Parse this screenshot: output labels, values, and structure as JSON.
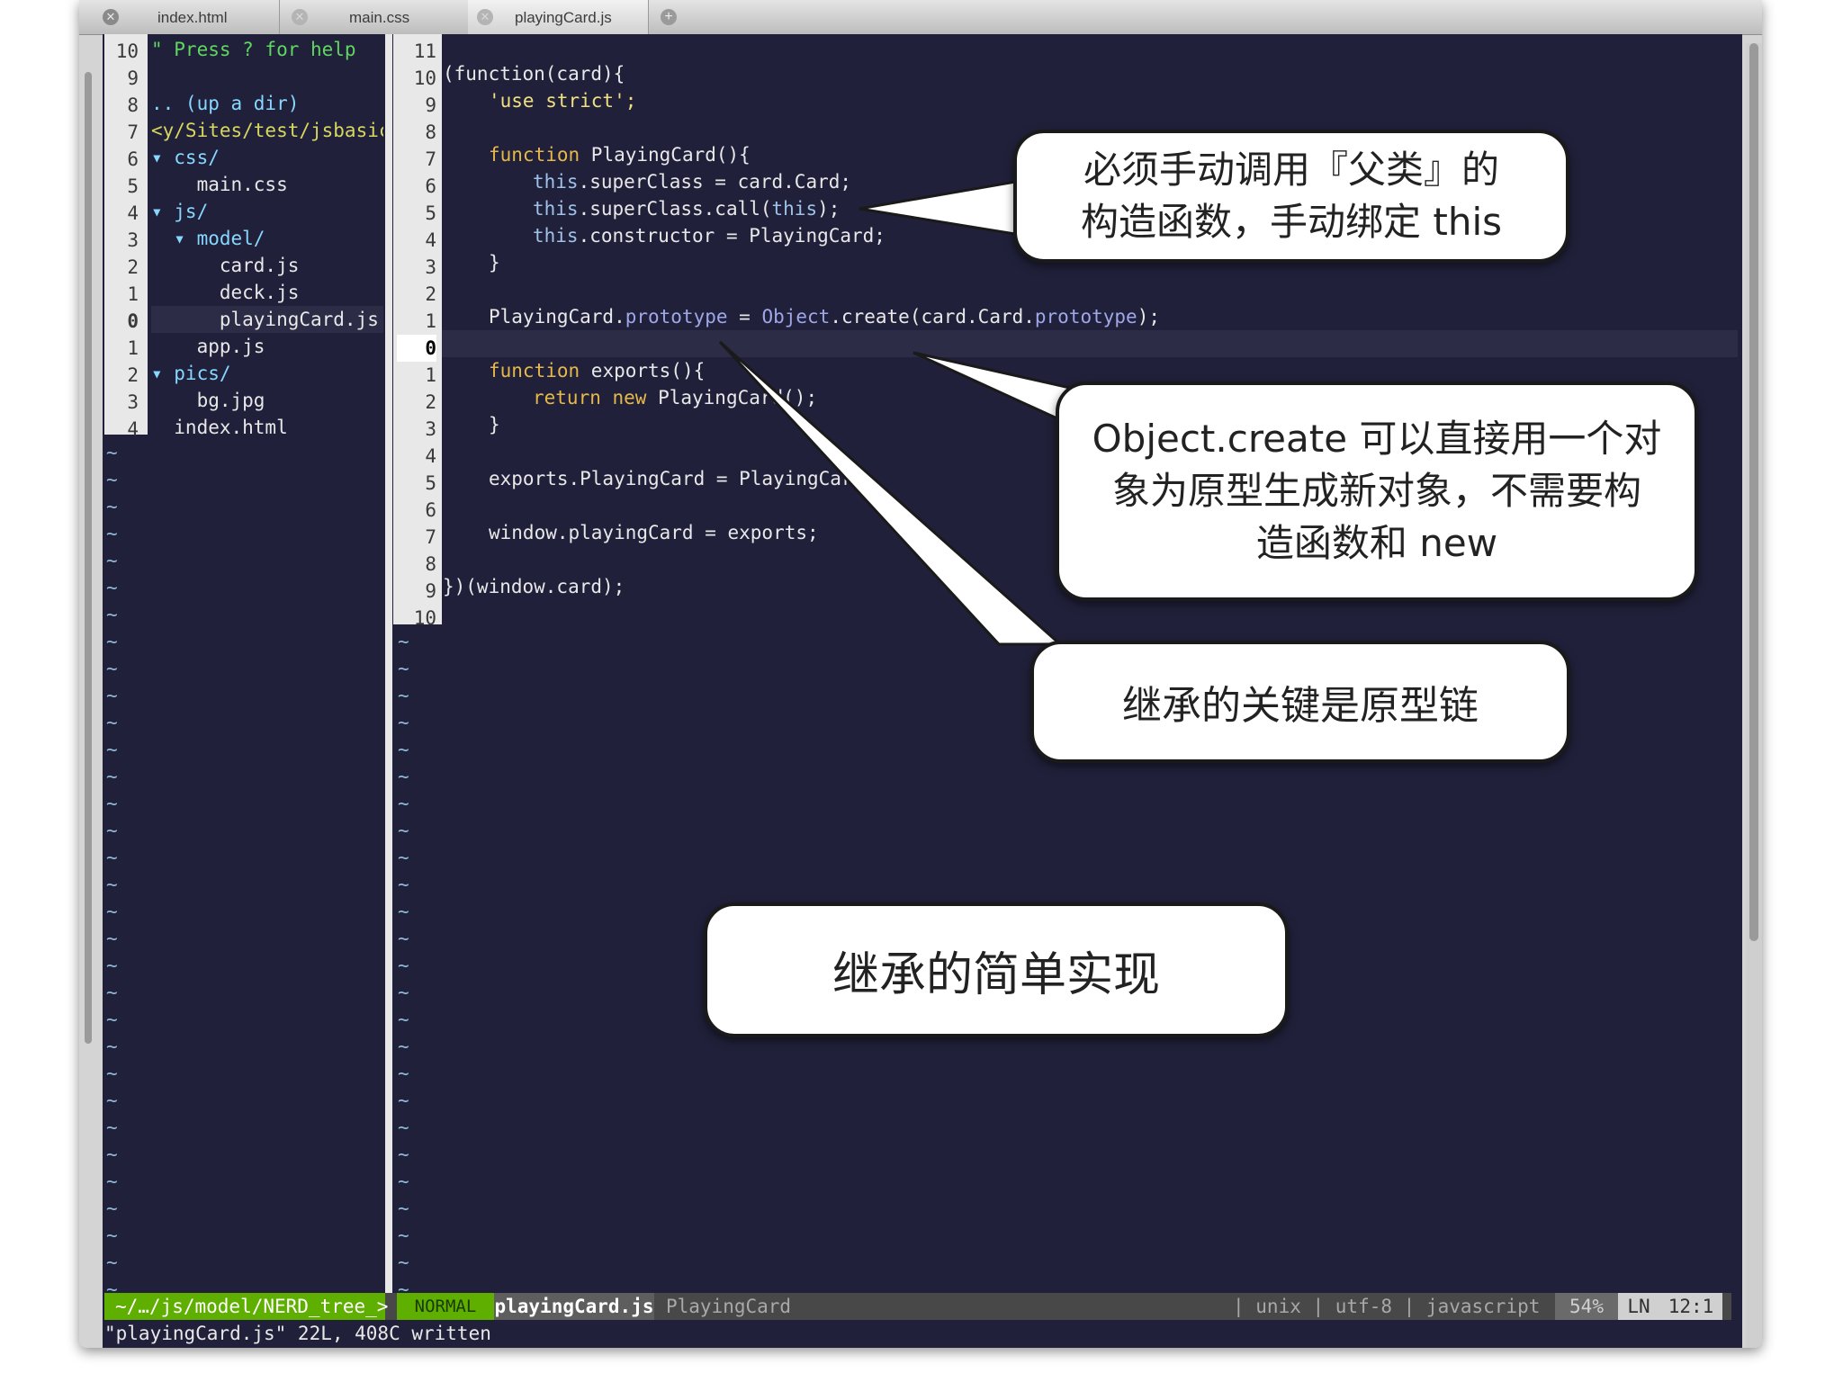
{
  "tabs": [
    {
      "label": "index.html"
    },
    {
      "label": "main.css"
    },
    {
      "label": "playingCard.js"
    }
  ],
  "tree": {
    "numbers": [
      "10",
      "9",
      "8",
      "7",
      "6",
      "5",
      "4",
      "3",
      "2",
      "1",
      "0",
      "1",
      "2",
      "3",
      "4"
    ],
    "lines": [
      {
        "text": "\" Press ? for help",
        "color": "#5fd75f"
      },
      {
        "text": "",
        "color": "#e8e8e8"
      },
      {
        "text": ".. (up a dir)",
        "color": "#87d7ff"
      },
      {
        "text": "<y/Sites/test/jsbasic/",
        "color": "#d7d75f"
      },
      {
        "text": "▾ css/",
        "color": "#87d7ff"
      },
      {
        "text": "    main.css",
        "color": "#e8e8e8"
      },
      {
        "text": "▾ js/",
        "color": "#87d7ff"
      },
      {
        "text": "  ▾ model/",
        "color": "#87d7ff"
      },
      {
        "text": "      card.js",
        "color": "#e8e8e8"
      },
      {
        "text": "      deck.js",
        "color": "#e8e8e8"
      },
      {
        "text": "      playingCard.js",
        "color": "#e8e8e8"
      },
      {
        "text": "    app.js",
        "color": "#e8e8e8"
      },
      {
        "text": "▾ pics/",
        "color": "#87d7ff"
      },
      {
        "text": "    bg.jpg",
        "color": "#e8e8e8"
      },
      {
        "text": "  index.html",
        "color": "#e8e8e8"
      }
    ]
  },
  "code": {
    "numbers": [
      "11",
      "10",
      "9",
      "8",
      "7",
      "6",
      "5",
      "4",
      "3",
      "2",
      "1",
      "0",
      "1",
      "2",
      "3",
      "4",
      "5",
      "6",
      "7",
      "8",
      "9",
      "10"
    ],
    "l1": "(function(card){",
    "l2": "'use strict';",
    "l4a": "function",
    "l4b": " PlayingCard(){",
    "l5a": "this",
    "l5b": ".superClass = card.Card;",
    "l6a": "this",
    "l6b": ".superClass.call(",
    "l6c": "this",
    "l6d": ");",
    "l7a": "this",
    "l7b": ".constructor = PlayingCard;",
    "l8": "}",
    "l10a": "PlayingCard.",
    "l10b": "prototype",
    "l10c": " = ",
    "l10d": "Object",
    "l10e": ".create(card.Card.",
    "l10f": "prototype",
    "l10g": ");",
    "l12a": "function",
    "l12b": " exports(){",
    "l13a": "return new",
    "l13b": " PlayingCard();",
    "l14": "}",
    "l16": "exports.PlayingCard = PlayingCard;",
    "l18": "window.playingCard = exports;",
    "l20": "})(window.card);"
  },
  "status": {
    "path": "~/…/js/model/NERD_tree_>",
    "mode": "NORMAL",
    "file": "playingCard.js",
    "tag": "PlayingCard",
    "info": "| unix | utf-8 | javascript",
    "percent": "54%",
    "ln": "LN",
    "pos": "12:1"
  },
  "cmdline": "\"playingCard.js\" 22L, 408C written",
  "callouts": {
    "c1_line1": "必须手动调用『父类』的",
    "c1_line2": "构造函数，手动绑定 this",
    "c2_line1": "Object.create 可以直接用一个对",
    "c2_line2": "象为原型生成新对象，不需要构",
    "c2_line3": "造函数和 new",
    "c3": "继承的关键是原型链",
    "c4": "继承的简单实现"
  },
  "colors": {
    "editor_bg": "#20203a",
    "keyword": "#e6b84a",
    "mode_bg": "#5faf00",
    "path_bg": "#5faf00"
  }
}
